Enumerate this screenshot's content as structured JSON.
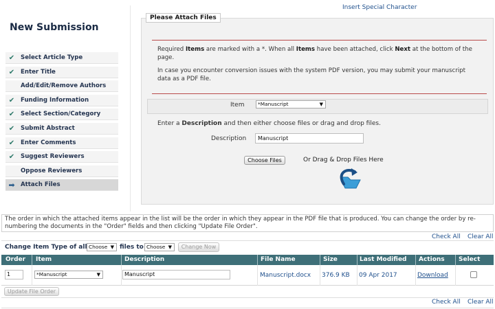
{
  "header": {
    "title": "New Submission",
    "insert_special_character": "Insert Special Character"
  },
  "steps": [
    {
      "label": "Select Article Type",
      "status": "done"
    },
    {
      "label": "Enter Title",
      "status": "done"
    },
    {
      "label": "Add/Edit/Remove Authors",
      "status": "none"
    },
    {
      "label": "Funding Information",
      "status": "done"
    },
    {
      "label": "Select Section/Category",
      "status": "done"
    },
    {
      "label": "Submit Abstract",
      "status": "done"
    },
    {
      "label": "Enter Comments",
      "status": "done"
    },
    {
      "label": "Suggest Reviewers",
      "status": "done"
    },
    {
      "label": "Oppose Reviewers",
      "status": "none"
    },
    {
      "label": "Attach Files",
      "status": "current"
    }
  ],
  "attach": {
    "panel_title": "Please Attach Files",
    "note1": {
      "p1": "Required ",
      "b1": "Items",
      "p2": " are marked with a *. When all ",
      "b2": "Items",
      "p3": " have been attached, click ",
      "b3": "Next",
      "p4": " at the bottom of the page."
    },
    "note2": "In case you encounter conversion issues with the system PDF version, you may submit your manuscript data as a PDF file.",
    "item_label": "Item",
    "item_value": "*Manuscript",
    "desc_instruction": {
      "p1": "Enter a ",
      "b1": "Description",
      "p2": " and then either choose files or drag and drop files."
    },
    "description_label": "Description",
    "description_value": "Manuscript",
    "choose_files": "Choose Files",
    "drop_text": "Or Drag & Drop Files Here"
  },
  "files": {
    "order_note": "The order in which the attached items appear in the list will be the order in which they appear in the PDF file that is produced. You can change the order by re-numbering the documents in the \"Order\" fields and then clicking \"Update File Order\".",
    "check_all": "Check All",
    "clear_all": "Clear All",
    "change_item_type_label": "Change Item Type of all",
    "files_to_label": "files to",
    "choose_option": "Choose",
    "change_now": "Change Now",
    "columns": [
      "Order",
      "Item",
      "Description",
      "File Name",
      "Size",
      "Last Modified",
      "Actions",
      "Select"
    ],
    "rows": [
      {
        "order": "1",
        "item": "*Manuscript",
        "description": "Manuscript",
        "file_name": "Manuscript.docx",
        "size": "376.9 KB",
        "last_modified": "09 Apr 2017",
        "action": "Download"
      }
    ],
    "update_file_order": "Update File Order"
  },
  "colors": {
    "table_header": "#3e6f78",
    "link": "#1e4f8c",
    "check": "#2f7a6b",
    "rule": "#b84a4a"
  }
}
